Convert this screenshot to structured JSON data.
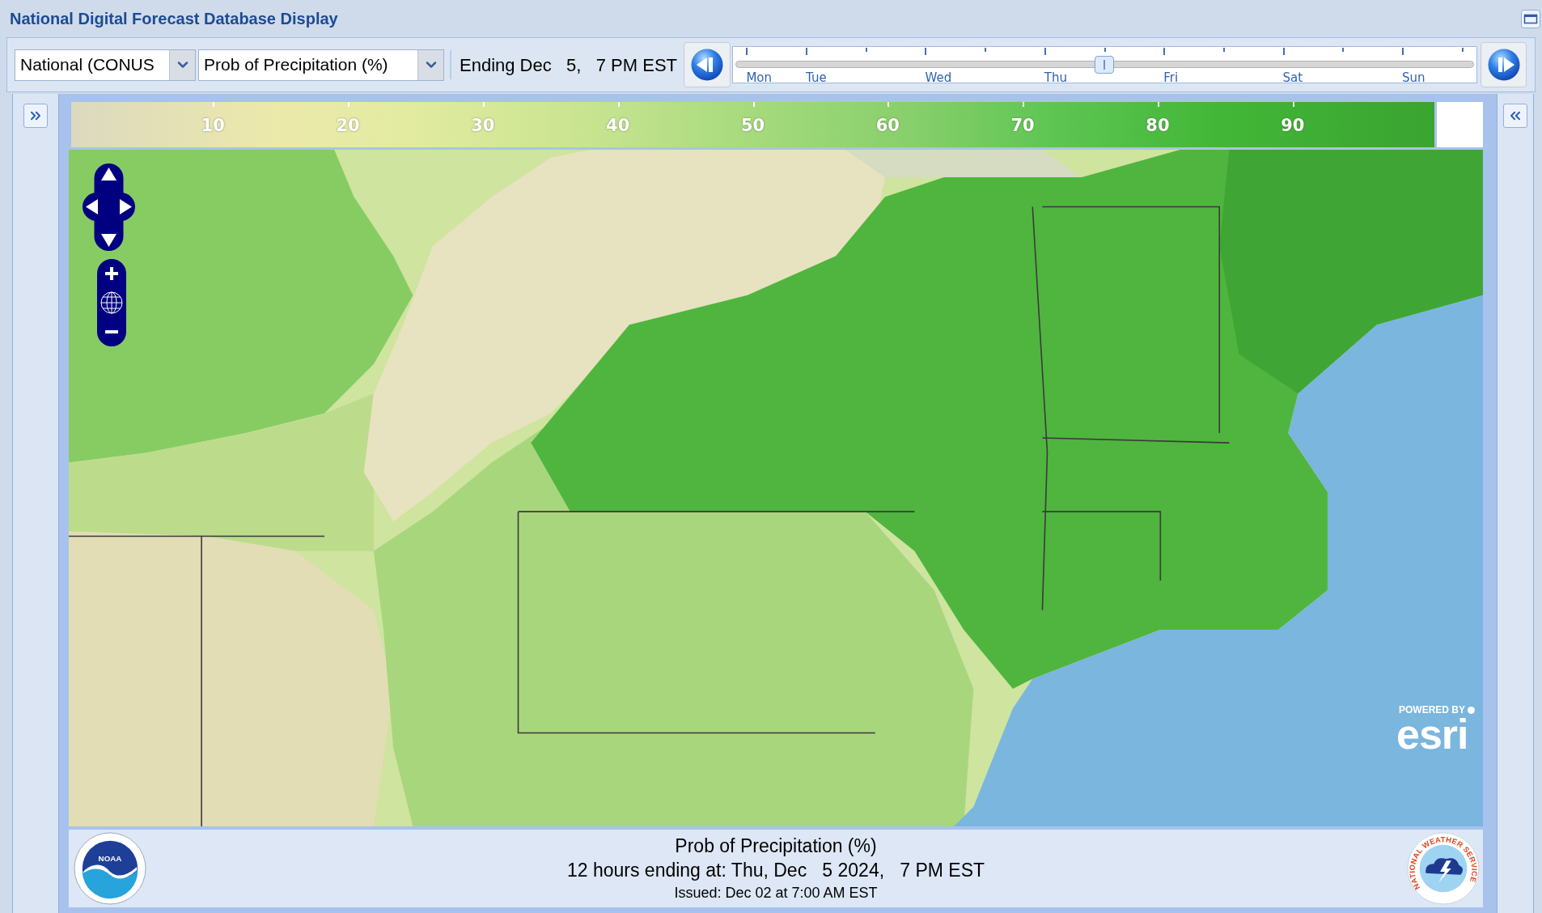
{
  "window": {
    "title": "National Digital Forecast Database Display"
  },
  "toolbar": {
    "region_select": {
      "value": "National (CONUS"
    },
    "element_select": {
      "value": "Prob of Precipitation (%)"
    },
    "period": "Ending Dec   5,   7 PM EST",
    "time_slider": {
      "days": [
        "Mon",
        "Tue",
        "Wed",
        "Thu",
        "Fri",
        "Sat",
        "Sun"
      ],
      "level": 0.499
    }
  },
  "legend": {
    "ticks": [
      "10",
      "20",
      "30",
      "40",
      "50",
      "60",
      "70",
      "80",
      "90"
    ]
  },
  "map": {
    "attribution": {
      "prefix": "POWERED BY",
      "wordmark": "esri"
    }
  },
  "footer": {
    "title": "Prob of Precipitation (%)",
    "valid_time": "12 hours ending at: Thu, Dec   5 2024,   7 PM EST",
    "issued": "Issued: Dec 02 at 7:00 AM EST",
    "left_logo": {
      "text": "NOAA"
    },
    "right_logo": {
      "text": "NATIONAL WEATHER SERVICE"
    }
  }
}
